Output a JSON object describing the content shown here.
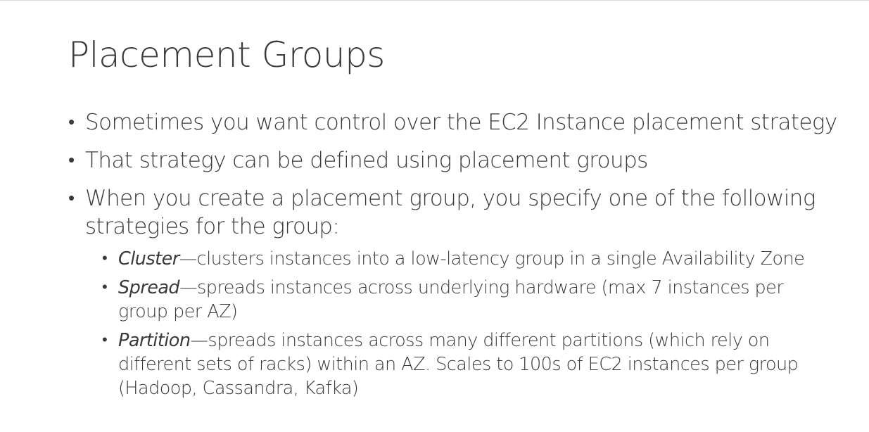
{
  "slide": {
    "title": "Placement Groups",
    "bullets": [
      "Sometimes you want control over the EC2 Instance placement strategy",
      "That strategy can be defined using placement groups",
      "When you create a placement group, you specify one of the following strategies for the group:"
    ],
    "strategies": [
      {
        "name": "Cluster",
        "description": "—clusters instances into a low-latency group in a single Availability Zone"
      },
      {
        "name": "Spread",
        "description": "—spreads instances across underlying hardware (max 7 instances per group per AZ)"
      },
      {
        "name": "Partition",
        "description": "—spreads instances across many different partitions (which rely on different sets of racks) within an AZ. Scales to 100s of EC2 instances per group (Hadoop, Cassandra, Kafka)"
      }
    ]
  }
}
